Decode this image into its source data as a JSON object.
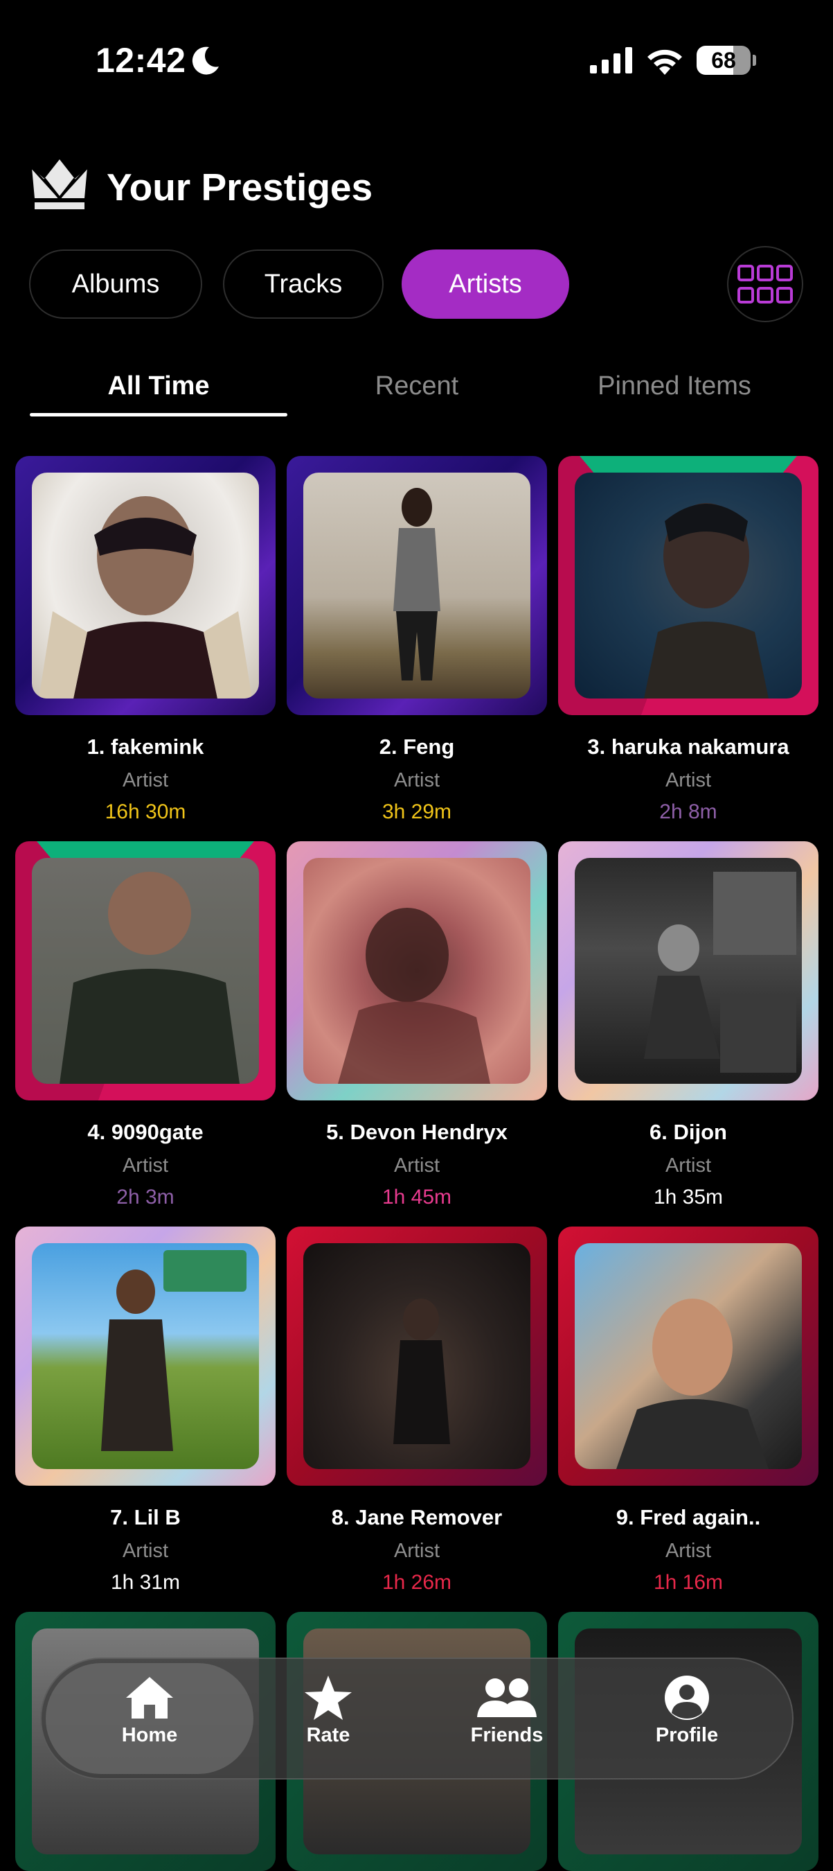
{
  "status_bar": {
    "time": "12:42",
    "battery": "68",
    "battery_level": 0.68
  },
  "header": {
    "title": "Your Prestiges"
  },
  "category_tabs": [
    "Albums",
    "Tracks",
    "Artists"
  ],
  "time_tabs": [
    "All Time",
    "Recent",
    "Pinned Items"
  ],
  "artists": [
    {
      "name": "1. fakemink",
      "type": "Artist",
      "duration": "16h 30m",
      "duration_color": "#f0c419"
    },
    {
      "name": "2. Feng",
      "type": "Artist",
      "duration": "3h 29m",
      "duration_color": "#f0c419"
    },
    {
      "name": "3. haruka nakamura",
      "type": "Artist",
      "duration": "2h 8m",
      "duration_color": "#8e5fa8"
    },
    {
      "name": "4. 9090gate",
      "type": "Artist",
      "duration": "2h 3m",
      "duration_color": "#8e5fa8"
    },
    {
      "name": "5. Devon Hendryx",
      "type": "Artist",
      "duration": "1h 45m",
      "duration_color": "#e83b8f"
    },
    {
      "name": "6. Dijon",
      "type": "Artist",
      "duration": "1h 35m",
      "duration_color": "#ffffff"
    },
    {
      "name": "7. Lil B",
      "type": "Artist",
      "duration": "1h 31m",
      "duration_color": "#ffffff"
    },
    {
      "name": "8. Jane Remover",
      "type": "Artist",
      "duration": "1h 26m",
      "duration_color": "#e8284a"
    },
    {
      "name": "9. Fred again..",
      "type": "Artist",
      "duration": "1h 16m",
      "duration_color": "#e8284a"
    }
  ],
  "nav": {
    "home": "Home",
    "rate": "Rate",
    "friends": "Friends",
    "profile": "Profile"
  },
  "colors": {
    "accent": "#a42cc4",
    "background": "#000000"
  }
}
